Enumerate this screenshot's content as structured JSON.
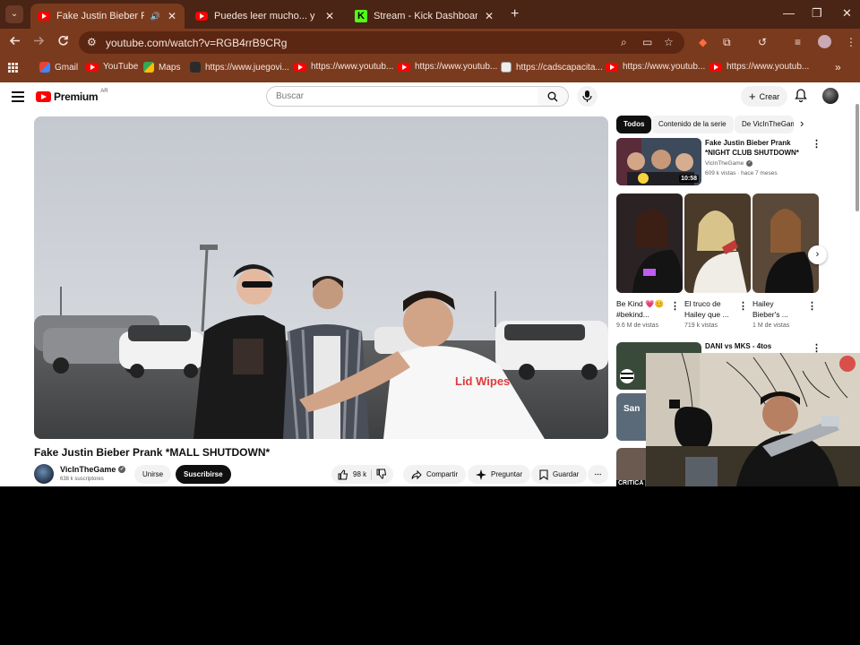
{
  "browser": {
    "tabs": [
      {
        "title": "Fake Justin Bieber Prank *M",
        "favicon": "youtube-icon",
        "active": true,
        "audio": true
      },
      {
        "title": "Puedes leer mucho... y no enten",
        "favicon": "youtube-icon",
        "active": false
      },
      {
        "title": "Stream - Kick Dashboard",
        "favicon": "kick-icon",
        "active": false
      }
    ],
    "url": "youtube.com/watch?v=RGB4rrB9CRg",
    "bookmarks": [
      {
        "label": "Gmail",
        "icon": "gmail-icon"
      },
      {
        "label": "YouTube",
        "icon": "youtube-icon"
      },
      {
        "label": "Maps",
        "icon": "maps-icon"
      },
      {
        "label": "https://www.juegovi...",
        "icon": "site-icon"
      },
      {
        "label": "https://www.youtub...",
        "icon": "youtube-icon"
      },
      {
        "label": "https://www.youtub...",
        "icon": "youtube-icon"
      },
      {
        "label": "https://cadscapacita...",
        "icon": "site-icon"
      },
      {
        "label": "https://www.youtub...",
        "icon": "youtube-icon"
      },
      {
        "label": "https://www.youtub...",
        "icon": "youtube-icon"
      }
    ],
    "colors": {
      "frame": "#4a2414",
      "toolbar": "#7a3a1e",
      "omnibox": "#5b2612"
    }
  },
  "youtube": {
    "logo_text": "Premium",
    "logo_sup": "AR",
    "search_placeholder": "Buscar",
    "create_label": "Crear",
    "video": {
      "title": "Fake Justin Bieber Prank *MALL SHUTDOWN*",
      "channel": "VicInTheGame",
      "subscribers": "638 k suscriptores",
      "join_label": "Unirse",
      "subscribe_label": "Suscribirse",
      "likes": "98 k",
      "share_label": "Compartir",
      "ask_label": "Preguntar",
      "save_label": "Guardar",
      "shirt_text": "Lid Wipes"
    },
    "chips": [
      "Todos",
      "Contenido de la serie",
      "De VicInTheGam"
    ],
    "recommended": {
      "title": "Fake Justin Bieber Prank *NIGHT CLUB SHUTDOWN*",
      "channel": "VicInTheGame",
      "meta": "609 k vistas · hace 7 meses",
      "duration": "10:58"
    },
    "shorts": [
      {
        "title": "Be Kind 💗😊 #bekind...",
        "views": "9.6 M de vistas"
      },
      {
        "title": "El truco de Hailey que ...",
        "views": "719 k vistas"
      },
      {
        "title": "Hailey Bieber's ...",
        "views": "1 M de vistas"
      }
    ],
    "next_title": "DANI vs MKS - 4tos",
    "thumb_labels": [
      "San",
      "CRITICA"
    ],
    "colors": {
      "brand": "#ff0000",
      "dark_button": "#0f0f0f"
    }
  }
}
